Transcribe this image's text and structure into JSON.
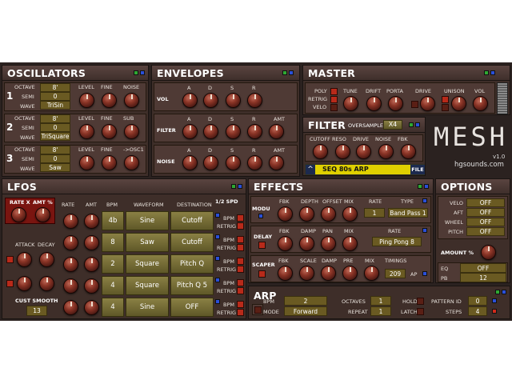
{
  "oscillators": {
    "title": "OSCILLATORS",
    "rows": [
      {
        "num": "1",
        "octave": "8'",
        "semi": "0",
        "wave": "TriSin",
        "labels": [
          "LEVEL",
          "FINE",
          "NOISE"
        ]
      },
      {
        "num": "2",
        "octave": "8'",
        "semi": "0",
        "wave": "TriSquare",
        "labels": [
          "LEVEL",
          "FINE",
          "SUB"
        ]
      },
      {
        "num": "3",
        "octave": "8'",
        "semi": "0",
        "wave": "Saw",
        "labels": [
          "LEVEL",
          "FINE",
          "->OSC1"
        ]
      }
    ],
    "field_labels": {
      "octave": "OCTAVE",
      "semi": "SEMI",
      "wave": "WAVE"
    }
  },
  "envelopes": {
    "title": "ENVELOPES",
    "rows": [
      {
        "name": "VOL",
        "labels": [
          "A",
          "D",
          "S",
          "R"
        ]
      },
      {
        "name": "FILTER",
        "labels": [
          "A",
          "D",
          "S",
          "R",
          "AMT"
        ]
      },
      {
        "name": "NOISE",
        "labels": [
          "A",
          "D",
          "S",
          "R",
          "AMT"
        ]
      }
    ]
  },
  "master": {
    "title": "MASTER",
    "toggles": [
      "POLY",
      "RETRIG",
      "VELO"
    ],
    "labels": [
      "TUNE",
      "DRIFT",
      "PORTA",
      "DRIVE",
      "UNISON",
      "VOL"
    ]
  },
  "filter": {
    "title": "FILTER",
    "oversample_label": "OVERSAMPLE",
    "oversample": "X4",
    "labels": [
      "CUTOFF",
      "RESO",
      "DRIVE",
      "NOISE",
      "FBK"
    ]
  },
  "logo": {
    "name": "MESH",
    "version": "v1.0",
    "site": "hgsounds.com"
  },
  "preset": {
    "arrow": "^",
    "name": "SEQ 80s ARP",
    "file": "FILE"
  },
  "lfos": {
    "title": "LFOS",
    "rate_x": "RATE X",
    "amt_pct": "AMT %",
    "attack": "ATTACK",
    "decay": "DECAY",
    "cust_smooth": "CUST SMOOTH",
    "smooth_value": "13",
    "half_spd": "1/2 SPD",
    "cols": [
      "RATE",
      "AMT",
      "BPM",
      "WAVEFORM",
      "DESTINATION"
    ],
    "bpm_label": "BPM",
    "retrig_label": "RETRIG",
    "rows": [
      {
        "bpm": "4b",
        "waveform": "Sine",
        "destination": "Cutoff"
      },
      {
        "bpm": "8",
        "waveform": "Saw",
        "destination": "Cutoff"
      },
      {
        "bpm": "2",
        "waveform": "Square",
        "destination": "Pitch Q"
      },
      {
        "bpm": "4",
        "waveform": "Square",
        "destination": "Pitch Q 5"
      },
      {
        "bpm": "4",
        "waveform": "Sine",
        "destination": "OFF"
      }
    ]
  },
  "effects": {
    "title": "EFFECTS",
    "modu": {
      "name": "MODU",
      "labels": [
        "FBK",
        "DEPTH",
        "OFFSET",
        "MIX",
        "RATE",
        "TYPE"
      ],
      "rate": "1",
      "type": "Band Pass 1"
    },
    "delay": {
      "name": "DELAY",
      "labels": [
        "FBK",
        "DAMP",
        "PAN",
        "MIX",
        "RATE"
      ],
      "rate": "Ping Pong 8"
    },
    "scaper": {
      "name": "SCAPER",
      "labels": [
        "FBK",
        "SCALE",
        "DAMP",
        "PRE",
        "MIX",
        "TIMINGS"
      ],
      "timings": "209",
      "ap": "AP"
    }
  },
  "options": {
    "title": "OPTIONS",
    "rows": [
      {
        "label": "VELO",
        "value": "OFF"
      },
      {
        "label": "AFT",
        "value": "OFF"
      },
      {
        "label": "WHEEL",
        "value": "OFF"
      },
      {
        "label": "PITCH",
        "value": "OFF"
      }
    ],
    "amount": "AMOUNT %",
    "eq_label": "EQ",
    "eq": "OFF",
    "pb_label": "PB",
    "pb": "12"
  },
  "arp": {
    "title": "ARP",
    "bpm_label": "BPM",
    "bpm": "2",
    "mode_label": "MODE",
    "mode": "Forward",
    "octaves_label": "OCTAVES",
    "octaves": "1",
    "repeat_label": "REPEAT",
    "repeat": "1",
    "hold": "HOLD",
    "latch": "LATCH",
    "pattern_label": "PATTERN ID",
    "pattern": "0",
    "steps_label": "STEPS",
    "steps": "4"
  }
}
